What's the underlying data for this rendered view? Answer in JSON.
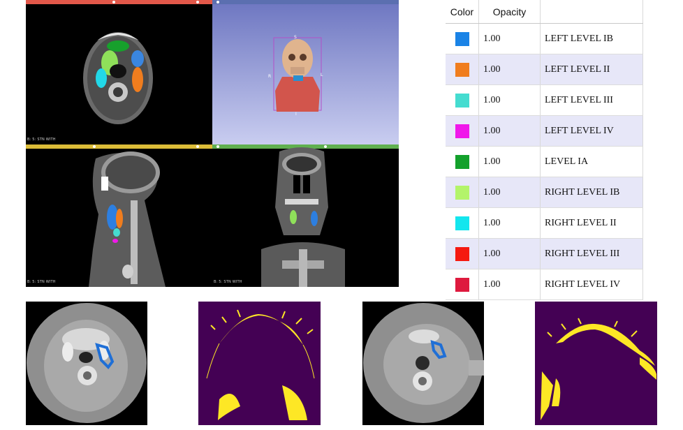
{
  "viewer": {
    "slice_label_axial": "B: 5: STN WITH",
    "slice_label_sagittal": "B: 5: STN WITH",
    "slice_label_coronal": "B: 5: STN WITH",
    "orient_s": "S",
    "orient_r": "R",
    "orient_l": "L",
    "orient_i": "I",
    "bar_colors": {
      "red": "#e2584a",
      "blue": "#5b6fb0",
      "yellow": "#dcbc38",
      "green": "#5fb04f"
    }
  },
  "segments": {
    "header_color": "Color",
    "header_opacity": "Opacity",
    "header_name": "",
    "rows": [
      {
        "color": "#1a83e6",
        "opacity": "1.00",
        "name": "LEFT LEVEL IB"
      },
      {
        "color": "#f07d1e",
        "opacity": "1.00",
        "name": "LEFT LEVEL II"
      },
      {
        "color": "#45dcd0",
        "opacity": "1.00",
        "name": "LEFT LEVEL III"
      },
      {
        "color": "#f018ea",
        "opacity": "1.00",
        "name": "LEFT LEVEL IV"
      },
      {
        "color": "#13a12c",
        "opacity": "1.00",
        "name": "LEVEL IA"
      },
      {
        "color": "#b3f46a",
        "opacity": "1.00",
        "name": "RIGHT LEVEL IB"
      },
      {
        "color": "#14e6ee",
        "opacity": "1.00",
        "name": "RIGHT LEVEL II"
      },
      {
        "color": "#f51a10",
        "opacity": "1.00",
        "name": "RIGHT LEVEL III"
      },
      {
        "color": "#de1a3e",
        "opacity": "1.00",
        "name": "RIGHT LEVEL IV"
      }
    ]
  },
  "thumbnails": {
    "ct_color": "#8f8f8f",
    "mask_background": "#440154",
    "mask_foreground": "#fde725",
    "contour_color": "#1f6fd6"
  }
}
